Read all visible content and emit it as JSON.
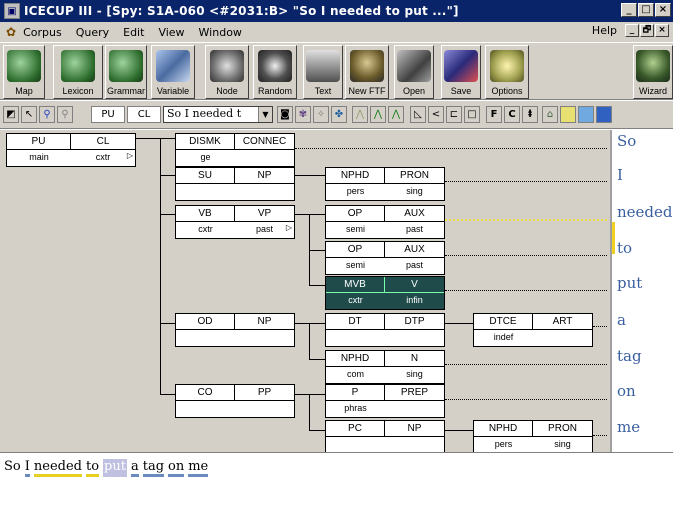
{
  "window": {
    "title": "ICECUP III - [Spy: S1A-060 <#2031:B> \"So I needed to put ...\"]",
    "app_icon": "icecup-icon",
    "controls": [
      "_",
      "□",
      "×"
    ]
  },
  "menu": {
    "items": [
      "Corpus",
      "Query",
      "Edit",
      "View",
      "Window"
    ],
    "help": "Help",
    "mdi_controls": [
      "_",
      "🗗",
      "×"
    ]
  },
  "toolbar": {
    "buttons": [
      {
        "label": "Map",
        "icon": "globe-icon",
        "color": "#3a7a3a"
      },
      {
        "label": "Lexicon",
        "icon": "globe-icon",
        "color": "#3a7a3a"
      },
      {
        "label": "Grammar",
        "icon": "globe-icon",
        "color": "#3a7a3a"
      },
      {
        "label": "Variable",
        "icon": "variable-icon",
        "color": "#4a6aa0"
      },
      {
        "label": "Node",
        "icon": "node-icon",
        "color": "#6a6a6a"
      },
      {
        "label": "Random",
        "icon": "dice-icon",
        "color": "#404040"
      },
      {
        "label": "Text",
        "icon": "text-icon",
        "color": "#505050"
      },
      {
        "label": "New FTF",
        "icon": "tree-icon",
        "color": "#6a5a2a"
      },
      {
        "label": "Open",
        "icon": "open-icon",
        "color": "#505050"
      },
      {
        "label": "Save",
        "icon": "save-icon",
        "color": "#3a3a8a"
      },
      {
        "label": "Options",
        "icon": "options-icon",
        "color": "#8a8a3a"
      },
      {
        "label": "Wizard",
        "icon": "wizard-icon",
        "color": "#4a6a2a"
      }
    ]
  },
  "toolbar2": {
    "pu": "PU",
    "cl": "CL",
    "combo_value": "So I needed t",
    "fuzzy_f": "F",
    "fuzzy_c": "C"
  },
  "tree": {
    "root": {
      "func": "PU",
      "cat": "CL",
      "f2": "main",
      "c2": "cxtr"
    },
    "nodes": [
      {
        "id": "dismk",
        "func": "DISMK",
        "cat": "CONNEC",
        "f2": "ge",
        "c2": ""
      },
      {
        "id": "su",
        "func": "SU",
        "cat": "NP",
        "f2": "",
        "c2": ""
      },
      {
        "id": "vb",
        "func": "VB",
        "cat": "VP",
        "f2": "cxtr",
        "c2": "past"
      },
      {
        "id": "od",
        "func": "OD",
        "cat": "NP",
        "f2": "",
        "c2": ""
      },
      {
        "id": "co",
        "func": "CO",
        "cat": "PP",
        "f2": "",
        "c2": ""
      },
      {
        "id": "nphd1",
        "func": "NPHD",
        "cat": "PRON",
        "f2": "pers",
        "c2": "sing"
      },
      {
        "id": "op1",
        "func": "OP",
        "cat": "AUX",
        "f2": "semi",
        "c2": "past"
      },
      {
        "id": "op2",
        "func": "OP",
        "cat": "AUX",
        "f2": "semi",
        "c2": "past"
      },
      {
        "id": "mvb",
        "func": "MVB",
        "cat": "V",
        "f2": "cxtr",
        "c2": "infin"
      },
      {
        "id": "dt",
        "func": "DT",
        "cat": "DTP",
        "f2": "",
        "c2": ""
      },
      {
        "id": "nphd2",
        "func": "NPHD",
        "cat": "N",
        "f2": "com",
        "c2": "sing"
      },
      {
        "id": "p",
        "func": "P",
        "cat": "PREP",
        "f2": "phras",
        "c2": ""
      },
      {
        "id": "pc",
        "func": "PC",
        "cat": "NP",
        "f2": "",
        "c2": ""
      },
      {
        "id": "dtce",
        "func": "DTCE",
        "cat": "ART",
        "f2": "indef",
        "c2": ""
      },
      {
        "id": "nphd3",
        "func": "NPHD",
        "cat": "PRON",
        "f2": "pers",
        "c2": "sing"
      }
    ]
  },
  "words": [
    "So",
    "I",
    "needed",
    "to",
    "put",
    "a",
    "tag",
    "on",
    "me"
  ],
  "sentence": [
    "So",
    "I",
    "needed",
    "to",
    "put",
    "a",
    "tag",
    "on",
    "me"
  ],
  "colors": {
    "title_bg": "#0a246a",
    "selected_node": "#1f4b4b",
    "highlight_yellow": "#f0d020",
    "word_color": "#3a5fa0"
  }
}
